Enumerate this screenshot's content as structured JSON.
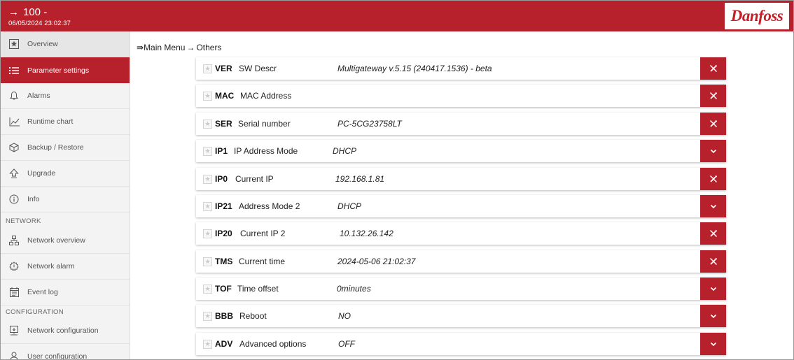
{
  "header": {
    "arrow": "→",
    "title": "100 -",
    "timestamp": "06/05/2024 23:02:37",
    "logo_text": "Danfoss"
  },
  "sidebar": {
    "items": [
      {
        "label": "Overview",
        "icon": "star-box-icon",
        "state": "selected"
      },
      {
        "label": "Parameter settings",
        "icon": "list-icon",
        "state": "active"
      },
      {
        "label": "Alarms",
        "icon": "bell-icon",
        "state": ""
      },
      {
        "label": "Runtime chart",
        "icon": "line-chart-icon",
        "state": ""
      },
      {
        "label": "Backup / Restore",
        "icon": "box-icon",
        "state": ""
      },
      {
        "label": "Upgrade",
        "icon": "upgrade-arrow-icon",
        "state": ""
      },
      {
        "label": "Info",
        "icon": "info-icon",
        "state": ""
      }
    ],
    "network_heading": "NETWORK",
    "network_items": [
      {
        "label": "Network overview",
        "icon": "network-tree-icon"
      },
      {
        "label": "Network alarm",
        "icon": "network-alarm-icon"
      },
      {
        "label": "Event log",
        "icon": "calendar-log-icon"
      }
    ],
    "config_heading": "CONFIGURATION",
    "config_items": [
      {
        "label": "Network configuration",
        "icon": "network-config-icon"
      },
      {
        "label": "User configuration",
        "icon": "user-icon"
      }
    ]
  },
  "breadcrumb": {
    "prefix_icon": "⇛",
    "items": [
      "Main Menu",
      "Others"
    ],
    "separator": "→"
  },
  "params": [
    {
      "code": "VER",
      "name": "SW Descr",
      "value": "Multigateway v.5.15 (240417.1536) - beta",
      "action": "edit-disabled"
    },
    {
      "code": "MAC",
      "name": "MAC Address",
      "value": "",
      "action": "edit-disabled"
    },
    {
      "code": "SER",
      "name": "Serial number",
      "value": "PC-5CG23758LT",
      "action": "edit-disabled"
    },
    {
      "code": "IP1",
      "name": "IP Address Mode",
      "value": "DHCP",
      "action": "dropdown"
    },
    {
      "code": "IP0",
      "name": "Current IP",
      "value": "192.168.1.81",
      "action": "edit-disabled"
    },
    {
      "code": "IP21",
      "name": "Address Mode 2",
      "value": "DHCP",
      "action": "dropdown"
    },
    {
      "code": "IP20",
      "name": "Current IP 2",
      "value": "10.132.26.142",
      "action": "edit-disabled"
    },
    {
      "code": "TMS",
      "name": "Current time",
      "value": "2024-05-06 21:02:37",
      "action": "edit-disabled"
    },
    {
      "code": "TOF",
      "name": "Time offset",
      "value": "0minutes",
      "action": "dropdown"
    },
    {
      "code": "BBB",
      "name": "Reboot",
      "value": "NO",
      "action": "dropdown"
    },
    {
      "code": "ADV",
      "name": "Advanced options",
      "value": "OFF",
      "action": "dropdown"
    }
  ],
  "colors": {
    "brand_red": "#b7212b",
    "sidebar_bg": "#f3f3f3"
  }
}
